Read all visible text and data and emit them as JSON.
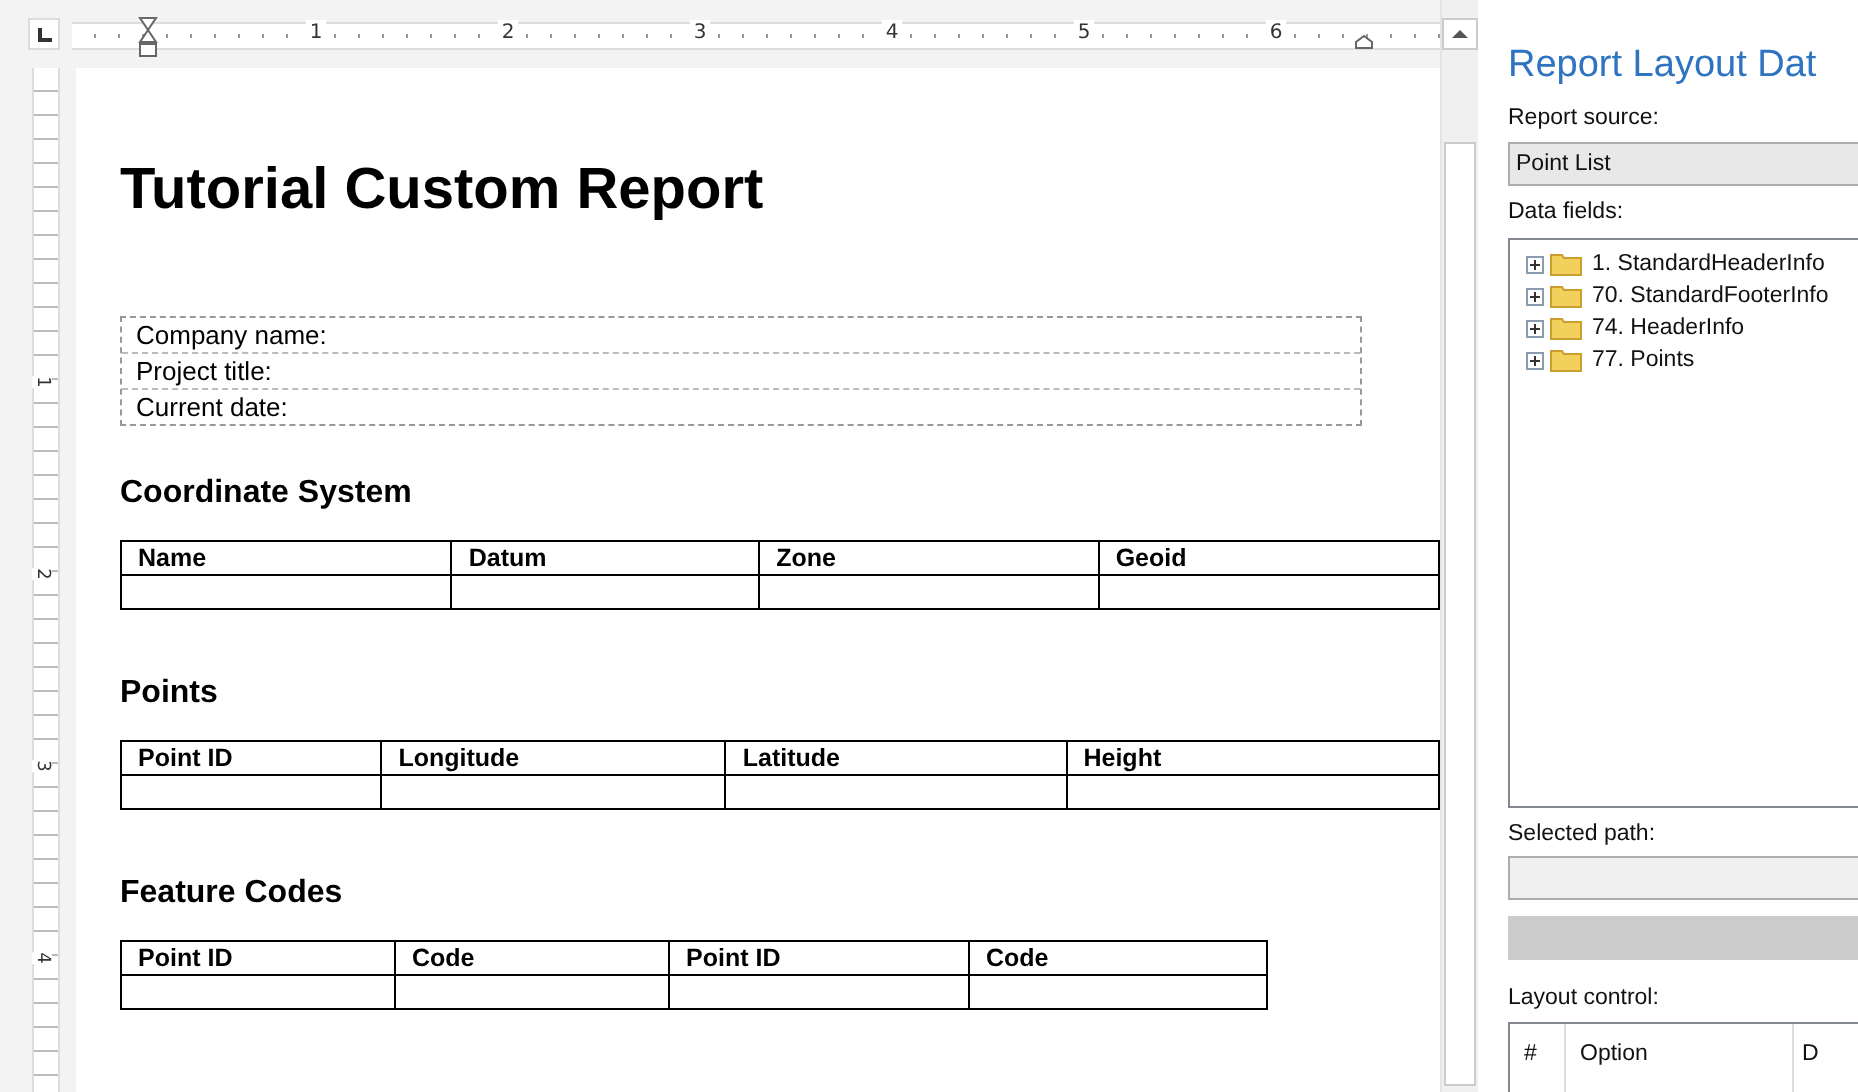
{
  "ruler": {
    "h_numbers": [
      "1",
      "2",
      "3",
      "4",
      "5",
      "6"
    ],
    "v_numbers": [
      "1",
      "2",
      "3",
      "4"
    ]
  },
  "document": {
    "title": "Tutorial Custom Report",
    "info_fields": [
      "Company name:",
      "Project title:",
      "Current date:"
    ],
    "sections": [
      {
        "heading": "Coordinate System",
        "columns": [
          "Name",
          "Datum",
          "Zone",
          "Geoid"
        ]
      },
      {
        "heading": "Points",
        "columns": [
          "Point ID",
          "Longitude",
          "Latitude",
          "Height"
        ]
      },
      {
        "heading": "Feature Codes",
        "columns": [
          "Point ID",
          "Code",
          "Point ID",
          "Code"
        ]
      }
    ]
  },
  "panel": {
    "title": "Report Layout Dat",
    "report_source_label": "Report source:",
    "report_source_value": "Point List",
    "data_fields_label": "Data fields:",
    "tree": [
      {
        "label": "1. StandardHeaderInfo",
        "expanded": false
      },
      {
        "label": "70. StandardFooterInfo",
        "expanded": false
      },
      {
        "label": "74. HeaderInfo",
        "expanded": false
      },
      {
        "label": "77. Points",
        "expanded": false
      }
    ],
    "selected_path_label": "Selected path:",
    "layout_control_label": "Layout control:",
    "layout_columns": [
      "#",
      "Option",
      "D"
    ]
  }
}
